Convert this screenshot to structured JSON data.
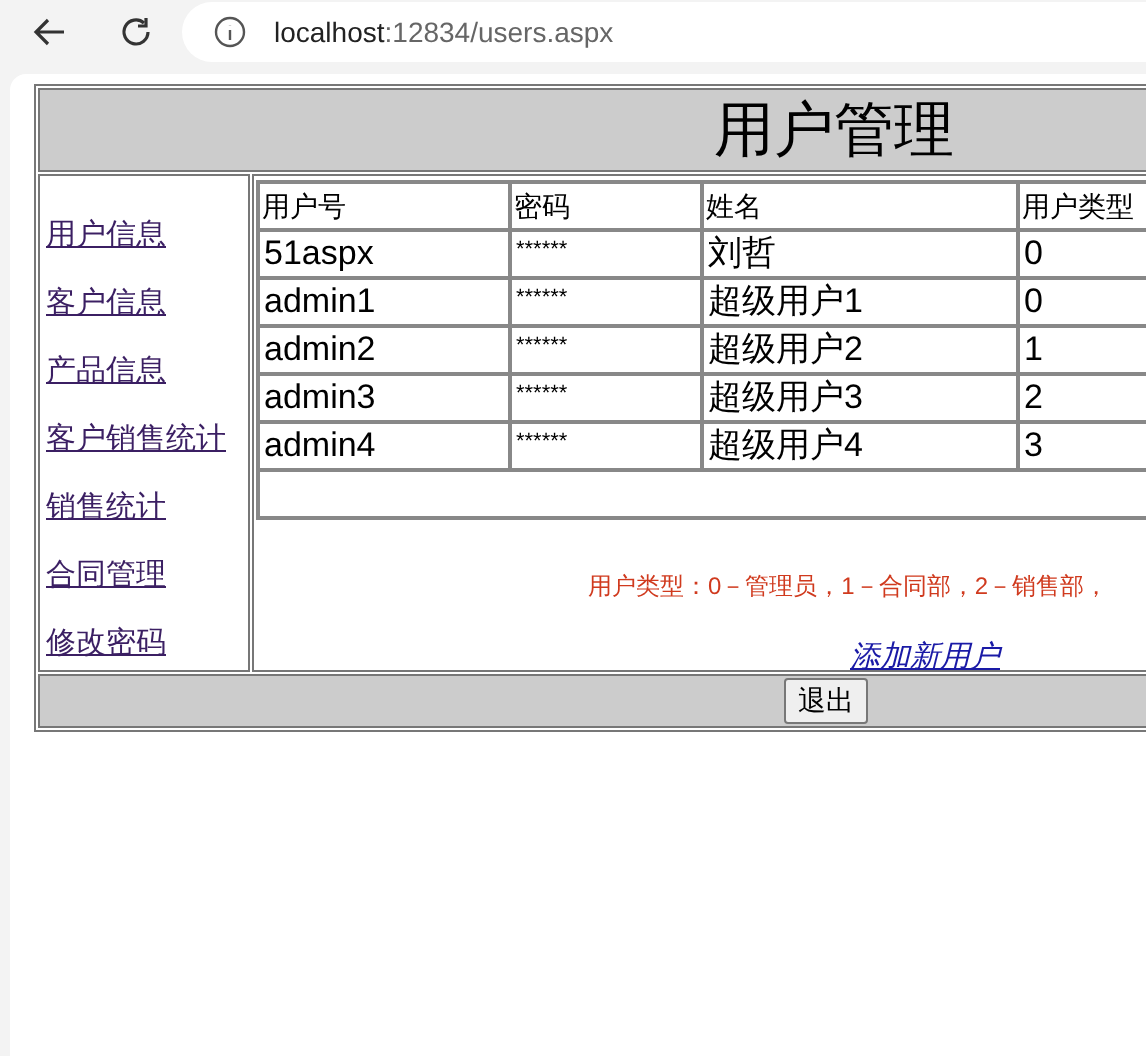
{
  "browser": {
    "url_host": "localhost",
    "url_path": ":12834/users.aspx"
  },
  "title": "用户管理",
  "sidebar": {
    "items": [
      {
        "label": "用户信息"
      },
      {
        "label": "客户信息"
      },
      {
        "label": "产品信息"
      },
      {
        "label": "客户销售统计"
      },
      {
        "label": "销售统计"
      },
      {
        "label": "合同管理"
      },
      {
        "label": "修改密码"
      }
    ]
  },
  "table": {
    "columns": [
      "用户号",
      "密码",
      "姓名",
      "用户类型"
    ],
    "rows": [
      [
        "51aspx",
        "******",
        "刘哲",
        "0"
      ],
      [
        "admin1",
        "******",
        "超级用户1",
        "0"
      ],
      [
        "admin2",
        "******",
        "超级用户2",
        "1"
      ],
      [
        "admin3",
        "******",
        "超级用户3",
        "2"
      ],
      [
        "admin4",
        "******",
        "超级用户4",
        "3"
      ]
    ]
  },
  "note": "用户类型：0－管理员，1－合同部，2－销售部，",
  "add_link": "添加新用户",
  "exit_button": "退出"
}
